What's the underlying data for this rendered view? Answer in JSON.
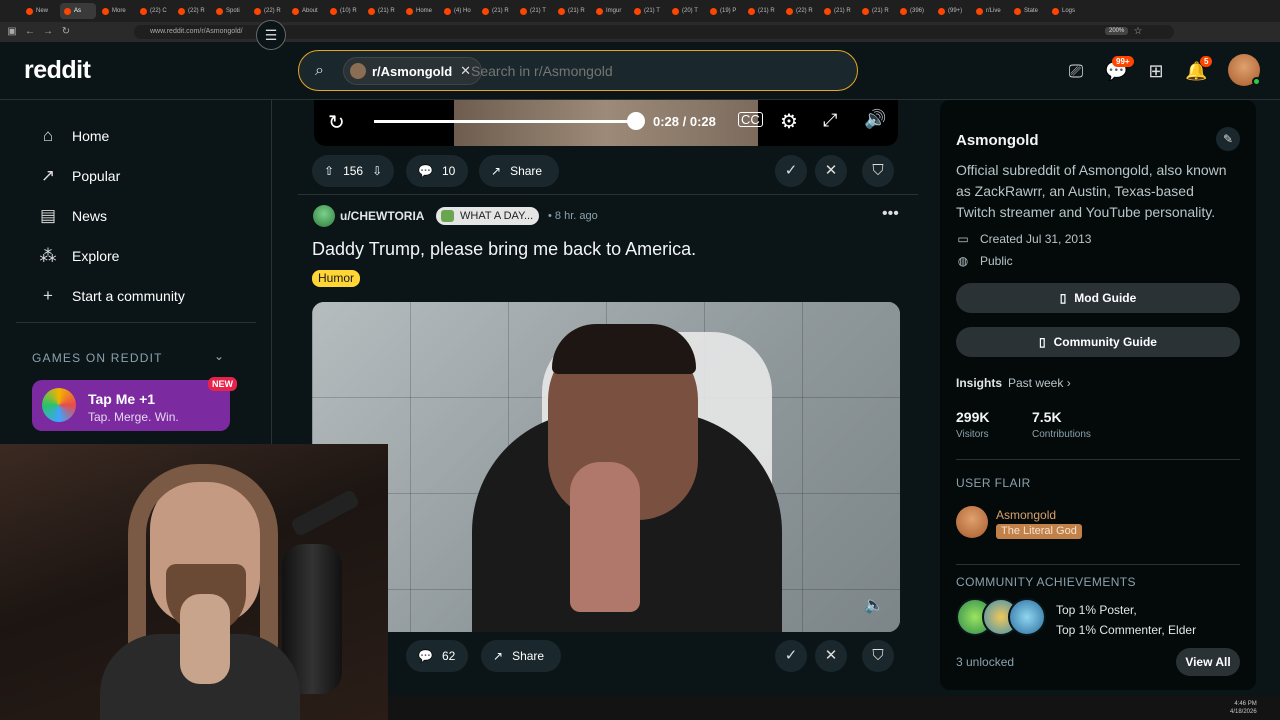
{
  "browser": {
    "tabs": [
      {
        "label": "New"
      },
      {
        "label": "As",
        "active": true
      },
      {
        "label": "More"
      },
      {
        "label": "(22) C"
      },
      {
        "label": "(22) R"
      },
      {
        "label": "Spoti"
      },
      {
        "label": "(22) R"
      },
      {
        "label": "About"
      },
      {
        "label": "(10) R"
      },
      {
        "label": "(21) R"
      },
      {
        "label": "Home"
      },
      {
        "label": "(4) Ho"
      },
      {
        "label": "(21) R"
      },
      {
        "label": "(21) T"
      },
      {
        "label": "(21) R"
      },
      {
        "label": "Imgur"
      },
      {
        "label": "(21) T"
      },
      {
        "label": "(20) T"
      },
      {
        "label": "(19) P"
      },
      {
        "label": "(21) R"
      },
      {
        "label": "(22) R"
      },
      {
        "label": "(21) R"
      },
      {
        "label": "(21) R"
      },
      {
        "label": "(396)"
      },
      {
        "label": "(99+)"
      },
      {
        "label": "r/Live"
      },
      {
        "label": "State"
      },
      {
        "label": "Logs"
      }
    ],
    "url": "www.reddit.com/r/Asmongold/",
    "zoom": "200%"
  },
  "header": {
    "logo": "reddit",
    "search_chip": "r/Asmongold",
    "search_placeholder": "Search in r/Asmongold",
    "chat_badge": "99+",
    "notif_badge": "5"
  },
  "sidebar": {
    "items": [
      {
        "label": "Home",
        "icon": "home-icon"
      },
      {
        "label": "Popular",
        "icon": "popular-icon"
      },
      {
        "label": "News",
        "icon": "news-icon"
      },
      {
        "label": "Explore",
        "icon": "explore-icon"
      },
      {
        "label": "Start a community",
        "icon": "plus-icon"
      }
    ],
    "games_header": "GAMES ON REDDIT",
    "game": {
      "title": "Tap Me +1",
      "subtitle": "Tap. Merge. Win.",
      "badge": "NEW"
    }
  },
  "video": {
    "time": "0:28 / 0:28",
    "progress": 1.0
  },
  "prev_post": {
    "votes": "156",
    "comments": "10",
    "share": "Share"
  },
  "post": {
    "author": "u/CHEWTORIA",
    "user_flair": "WHAT A DAY...",
    "time": "• 8 hr. ago",
    "title": "Daddy Trump, please bring me back to America.",
    "flair": "Humor",
    "comments": "62",
    "share": "Share"
  },
  "community": {
    "name": "Asmongold",
    "description": "Official subreddit of Asmongold, also known as ZackRawrr, an Austin, Texas-based Twitch streamer and YouTube personality.",
    "created": "Created Jul 31, 2013",
    "visibility": "Public",
    "mod_guide": "Mod Guide",
    "community_guide": "Community Guide",
    "insights_label": "Insights",
    "insights_range": "Past week",
    "visitors_value": "299K",
    "visitors_label": "Visitors",
    "contributions_value": "7.5K",
    "contributions_label": "Contributions",
    "user_flair_header": "USER FLAIR",
    "flair_user": "Asmongold",
    "flair_tag": "The Literal God",
    "achievements_header": "COMMUNITY ACHIEVEMENTS",
    "achievements_line1": "Top 1% Poster,",
    "achievements_line2": "Top 1% Commenter, Elder",
    "unlocked": "3 unlocked",
    "view_all": "View All"
  },
  "system": {
    "time": "4:46 PM",
    "date": "4/18/2026"
  },
  "colors": {
    "accent": "#ff4500",
    "search_border": "#e6a623",
    "humor_flair": "#ffd635",
    "game_card": "#7b2aa0"
  }
}
